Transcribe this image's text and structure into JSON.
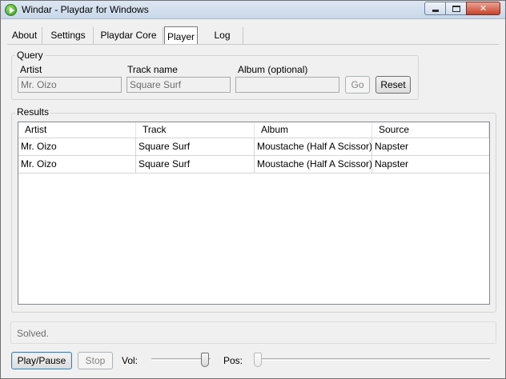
{
  "window": {
    "title": "Windar - Playdar for Windows",
    "minimize_icon": "minimize-icon",
    "maximize_icon": "maximize-icon",
    "close_icon": "close-icon"
  },
  "tabs": [
    {
      "label": "About"
    },
    {
      "label": "Settings"
    },
    {
      "label": "Playdar Core"
    },
    {
      "label": "Player",
      "active": true
    },
    {
      "label": "Log"
    }
  ],
  "query": {
    "group_label": "Query",
    "artist_label": "Artist",
    "artist_value": "Mr. Oizo",
    "track_label": "Track name",
    "track_value": "Square Surf",
    "album_label": "Album (optional)",
    "album_value": "",
    "go_label": "Go",
    "reset_label": "Reset"
  },
  "results": {
    "group_label": "Results",
    "columns": [
      "Artist",
      "Track",
      "Album",
      "Source"
    ],
    "rows": [
      [
        "Mr. Oizo",
        "Square Surf",
        "Moustache (Half A Scissor)",
        "Napster"
      ],
      [
        "Mr. Oizo",
        "Square Surf",
        "Moustache (Half A Scissor)",
        "Napster"
      ]
    ]
  },
  "status": {
    "text": "Solved."
  },
  "player": {
    "play_pause_label": "Play/Pause",
    "stop_label": "Stop",
    "vol_label": "Vol:",
    "volume_level": 0.97,
    "pos_label": "Pos:",
    "position_level": 0.0
  }
}
